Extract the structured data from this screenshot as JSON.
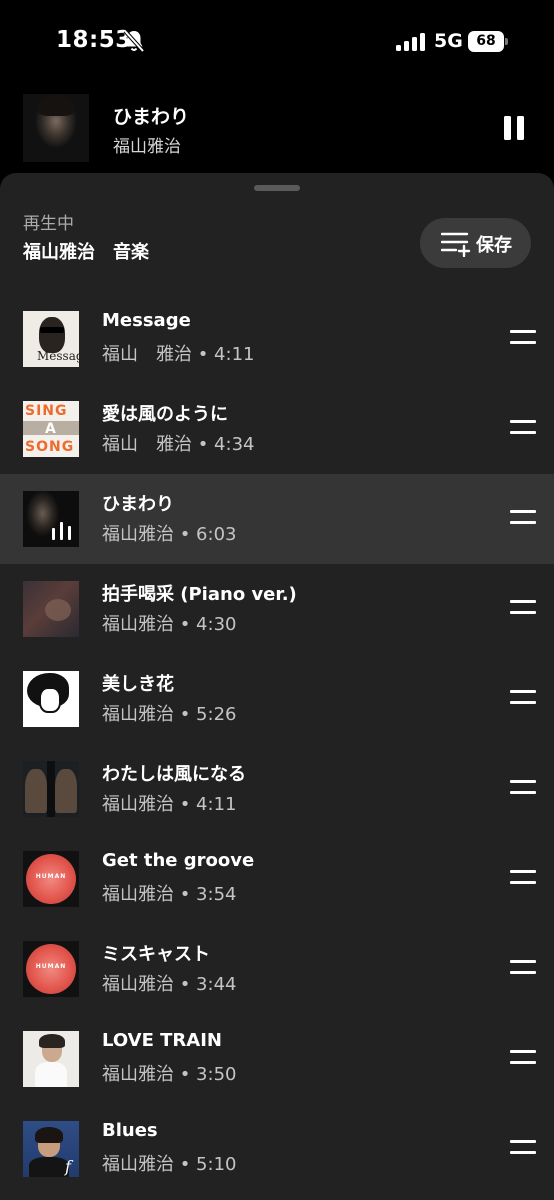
{
  "status_bar": {
    "time": "18:53",
    "network": "5G",
    "battery": "68"
  },
  "mini_player": {
    "title": "ひまわり",
    "artist": "福山雅治",
    "icon": "pause-icon"
  },
  "queue": {
    "now_playing_label": "再生中",
    "source": "福山雅治　音楽",
    "save_label": "保存",
    "tracks": [
      {
        "title": "Message",
        "meta": "福山　雅治 • 4:11",
        "art": "art-message"
      },
      {
        "title": "愛は風のように",
        "meta": "福山　雅治 • 4:34",
        "art": "art-sing"
      },
      {
        "title": "ひまわり",
        "meta": "福山雅治 • 6:03",
        "art": "art-himawari",
        "playing": true
      },
      {
        "title": "拍手喝采 (Piano ver.)",
        "meta": "福山雅治 • 4:30",
        "art": "art-hakushu"
      },
      {
        "title": "美しき花",
        "meta": "福山雅治 • 5:26",
        "art": "art-utsukushiki"
      },
      {
        "title": "わたしは風になる",
        "meta": "福山雅治 • 4:11",
        "art": "art-watashi"
      },
      {
        "title": "Get the groove",
        "meta": "福山雅治 • 3:54",
        "art": "art-human"
      },
      {
        "title": "ミスキャスト",
        "meta": "福山雅治 • 3:44",
        "art": "art-human"
      },
      {
        "title": "LOVE TRAIN",
        "meta": "福山雅治 • 3:50",
        "art": "art-love"
      },
      {
        "title": "Blues",
        "meta": "福山雅治 • 5:10",
        "art": "art-blues"
      }
    ]
  },
  "album_art_text": {
    "message_word": "Message",
    "sing_a_song": [
      "SING",
      "A",
      "SONG"
    ],
    "human": "HUMAN",
    "blues_script": "f"
  },
  "colors": {
    "background": "#000000",
    "sheet": "#222222",
    "active_row": "#353535",
    "save_button": "#3b3b3b",
    "secondary_text": "#c4c4c4",
    "sing_orange": "#ee6b2e"
  }
}
